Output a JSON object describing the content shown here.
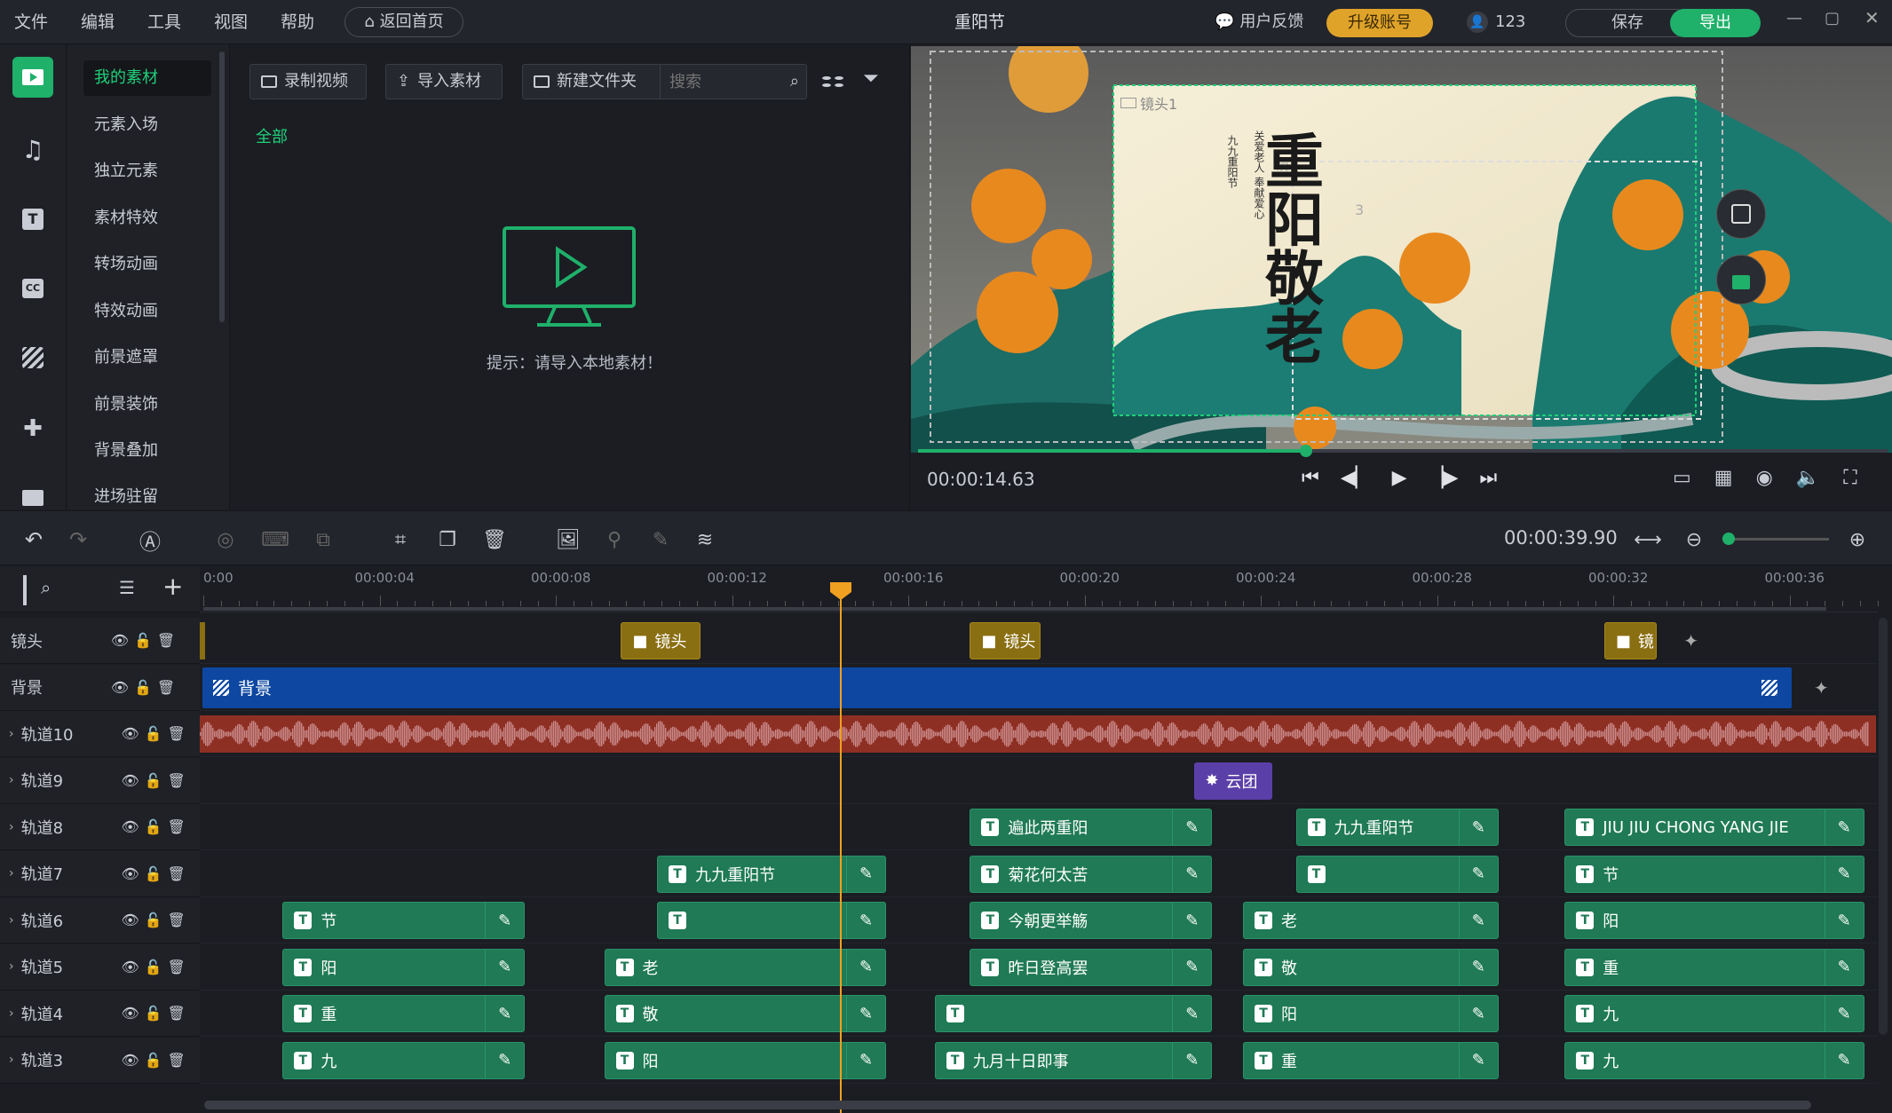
{
  "menu": {
    "file": "文件",
    "edit": "编辑",
    "tools": "工具",
    "view": "视图",
    "help": "帮助",
    "home": "返回首页"
  },
  "project_title": "重阳节",
  "header": {
    "feedback": "用户反馈",
    "upgrade": "升级账号",
    "user": "123",
    "save": "保存",
    "export": "导出"
  },
  "categories": [
    "我的素材",
    "元素入场",
    "独立元素",
    "素材特效",
    "转场动画",
    "特效动画",
    "前景遮罩",
    "前景装饰",
    "背景叠加",
    "进场驻留"
  ],
  "media": {
    "record": "录制视频",
    "import": "导入素材",
    "new_folder": "新建文件夹",
    "search_placeholder": "搜索",
    "filter_all": "全部",
    "hint": "提示：请导入本地素材！"
  },
  "preview": {
    "time": "00:00:14.63",
    "playback_fraction": 0.4,
    "title_art": "重阳敬老",
    "vertical_text_1": "九九重阳节",
    "vertical_text_2": "关爱老人 奉献爱心",
    "lens_label": "镜头1",
    "overlay_label_2": "镜",
    "overlay_label_3": "3"
  },
  "toolbar": {
    "total_time": "00:00:39.90"
  },
  "ruler": {
    "labels": [
      "0:00",
      "00:00:04",
      "00:00:08",
      "00:00:12",
      "00:00:16",
      "00:00:20",
      "00:00:24",
      "00:00:28",
      "00:00:32",
      "00:00:36"
    ]
  },
  "tracks": {
    "camera": {
      "name": "镜头",
      "clips": [
        "镜头",
        "镜头",
        "镜"
      ]
    },
    "background": {
      "name": "背景",
      "clip": "背景"
    },
    "t10": {
      "name": "轨道10"
    },
    "t9": {
      "name": "轨道9",
      "clip": "云团"
    },
    "t8": {
      "name": "轨道8",
      "clips": [
        "遍此两重阳",
        "九九重阳节",
        "JIU JIU CHONG YANG JIE"
      ]
    },
    "t7": {
      "name": "轨道7",
      "clips": [
        "九九重阳节",
        "菊花何太苦",
        "",
        "节"
      ]
    },
    "t6": {
      "name": "轨道6",
      "clips": [
        "节",
        "",
        "今朝更举觞",
        "老",
        "阳"
      ]
    },
    "t5": {
      "name": "轨道5",
      "clips": [
        "阳",
        "老",
        "昨日登高罢",
        "敬",
        "重"
      ]
    },
    "t4": {
      "name": "轨道4",
      "clips": [
        "重",
        "敬",
        "",
        "阳",
        "九"
      ]
    },
    "t3": {
      "name": "轨道3",
      "clips": [
        "九",
        "阳",
        "九月十日即事",
        "重",
        "九"
      ]
    }
  }
}
